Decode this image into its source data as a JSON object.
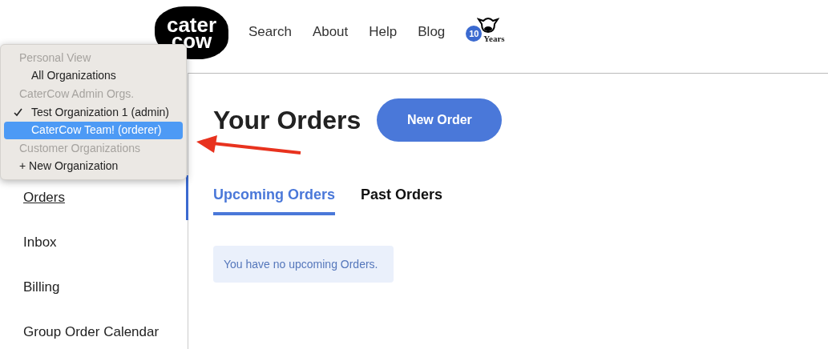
{
  "logo": {
    "lines": [
      "cater",
      "cow"
    ]
  },
  "nav": [
    {
      "label": "Search"
    },
    {
      "label": "About"
    },
    {
      "label": "Help"
    },
    {
      "label": "Blog"
    }
  ],
  "anniversary_badge": {
    "number": "10",
    "label": "Years"
  },
  "org_menu": [
    {
      "kind": "header",
      "label": "Personal View"
    },
    {
      "kind": "option",
      "label": "All Organizations",
      "checked": false,
      "selected": false
    },
    {
      "kind": "header",
      "label": "CaterCow Admin Orgs."
    },
    {
      "kind": "option",
      "label": "Test Organization 1 (admin)",
      "checked": true,
      "selected": false
    },
    {
      "kind": "option",
      "label": "CaterCow Team! (orderer)",
      "checked": false,
      "selected": true
    },
    {
      "kind": "header",
      "label": "Customer Organizations"
    },
    {
      "kind": "action",
      "label": "+ New Organization"
    }
  ],
  "sidebar": [
    {
      "label": "Orders",
      "selected": true
    },
    {
      "label": "Inbox",
      "selected": false
    },
    {
      "label": "Billing",
      "selected": false
    },
    {
      "label": "Group Order Calendar",
      "selected": false
    }
  ],
  "page": {
    "title": "Your Orders",
    "new_button": "New Order",
    "tabs": [
      {
        "label": "Upcoming Orders",
        "selected": true
      },
      {
        "label": "Past Orders",
        "selected": false
      }
    ],
    "empty_message": "You have no upcoming Orders."
  }
}
